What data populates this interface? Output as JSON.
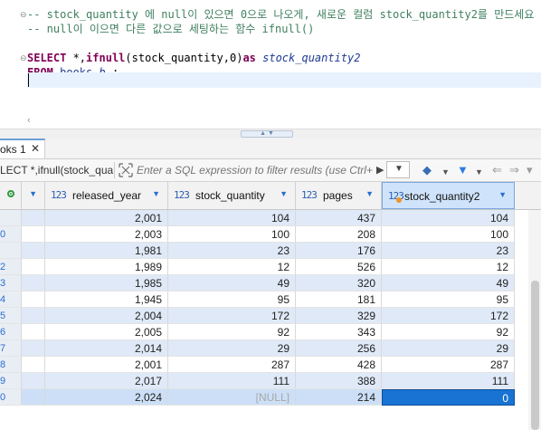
{
  "editor": {
    "comment1": "-- stock_quantity 에 null이 있으면 0으로 나오게, 새로운 컬럼 stock_quantity2를 만드세요",
    "comment2": "-- null이 이으면 다른 값으로 세팅하는 함수 ifnull()",
    "line3": {
      "select_kw": "SELECT",
      "cols": " *,",
      "ifnull_kw": "ifnull",
      "args": "(stock_quantity,0)",
      "as_kw": "as",
      "alias": " stock_quantity2"
    },
    "line4": {
      "from_kw": "FROM",
      "table": " books",
      "alias": " b",
      "semicolon": " ;"
    }
  },
  "result_tab": {
    "label": "oks 1",
    "close": "✕"
  },
  "filter_bar": {
    "query_crumb": "LECT *,ifnull(stock_quar",
    "filter_placeholder": "Enter a SQL expression to filter results (use Ctrl+",
    "icons": [
      "filter-expression-icon",
      "apply-arrow-icon",
      "history-dropdown-icon",
      "eraser-icon",
      "funnel-icon",
      "back-icon",
      "forward-icon"
    ]
  },
  "columns": [
    {
      "type": "123",
      "name": "released_year"
    },
    {
      "type": "123",
      "name": "stock_quantity"
    },
    {
      "type": "123",
      "name": "pages"
    },
    {
      "type": "123",
      "name": "stock_quantity2"
    }
  ],
  "rows": [
    {
      "rn": "",
      "released_year": "2,001",
      "stock_quantity": "104",
      "pages": "437",
      "stock_quantity2": "104"
    },
    {
      "rn": "0",
      "released_year": "2,003",
      "stock_quantity": "100",
      "pages": "208",
      "stock_quantity2": "100"
    },
    {
      "rn": "",
      "released_year": "1,981",
      "stock_quantity": "23",
      "pages": "176",
      "stock_quantity2": "23"
    },
    {
      "rn": "2",
      "released_year": "1,989",
      "stock_quantity": "12",
      "pages": "526",
      "stock_quantity2": "12"
    },
    {
      "rn": "3",
      "released_year": "1,985",
      "stock_quantity": "49",
      "pages": "320",
      "stock_quantity2": "49"
    },
    {
      "rn": "4",
      "released_year": "1,945",
      "stock_quantity": "95",
      "pages": "181",
      "stock_quantity2": "95"
    },
    {
      "rn": "5",
      "released_year": "2,004",
      "stock_quantity": "172",
      "pages": "329",
      "stock_quantity2": "172"
    },
    {
      "rn": "6",
      "released_year": "2,005",
      "stock_quantity": "92",
      "pages": "343",
      "stock_quantity2": "92"
    },
    {
      "rn": "7",
      "released_year": "2,014",
      "stock_quantity": "29",
      "pages": "256",
      "stock_quantity2": "29"
    },
    {
      "rn": "8",
      "released_year": "2,001",
      "stock_quantity": "287",
      "pages": "428",
      "stock_quantity2": "287"
    },
    {
      "rn": "9",
      "released_year": "2,017",
      "stock_quantity": "111",
      "pages": "388",
      "stock_quantity2": "111"
    },
    {
      "rn": "0",
      "released_year": "2,024",
      "stock_quantity": "[NULL]",
      "pages": "214",
      "stock_quantity2": "0"
    }
  ],
  "colors": {
    "keyword": "#7f0055",
    "comment": "#3f7f5f",
    "alias": "#1f3a93",
    "row_stripe": "#dfe9f7",
    "active_cell": "#1873d3",
    "new_column_dot": "#f29324"
  }
}
